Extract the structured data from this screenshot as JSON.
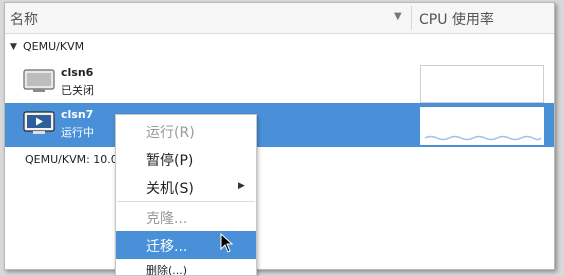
{
  "header": {
    "name_col": "名称",
    "cpu_col": "CPU 使用率"
  },
  "group": {
    "label": "QEMU/KVM"
  },
  "vms": [
    {
      "name": "clsn6",
      "status": "已关闭"
    },
    {
      "name": "clsn7",
      "status": "运行中"
    }
  ],
  "connection": {
    "label": "QEMU/KVM: 10.0."
  },
  "context_menu": {
    "run": "运行(R)",
    "pause": "暂停(P)",
    "shutdown": "关机(S)",
    "clone": "克隆...",
    "migrate": "迁移...",
    "delete": "删除(...)"
  },
  "colors": {
    "selection": "#4a90d9",
    "cpu_graph": "#cfe0f3"
  },
  "icons": [
    "sort-arrow-icon",
    "expander-triangle-icon",
    "vm-off-icon",
    "vm-running-icon",
    "submenu-arrow-icon",
    "mouse-cursor-icon"
  ]
}
